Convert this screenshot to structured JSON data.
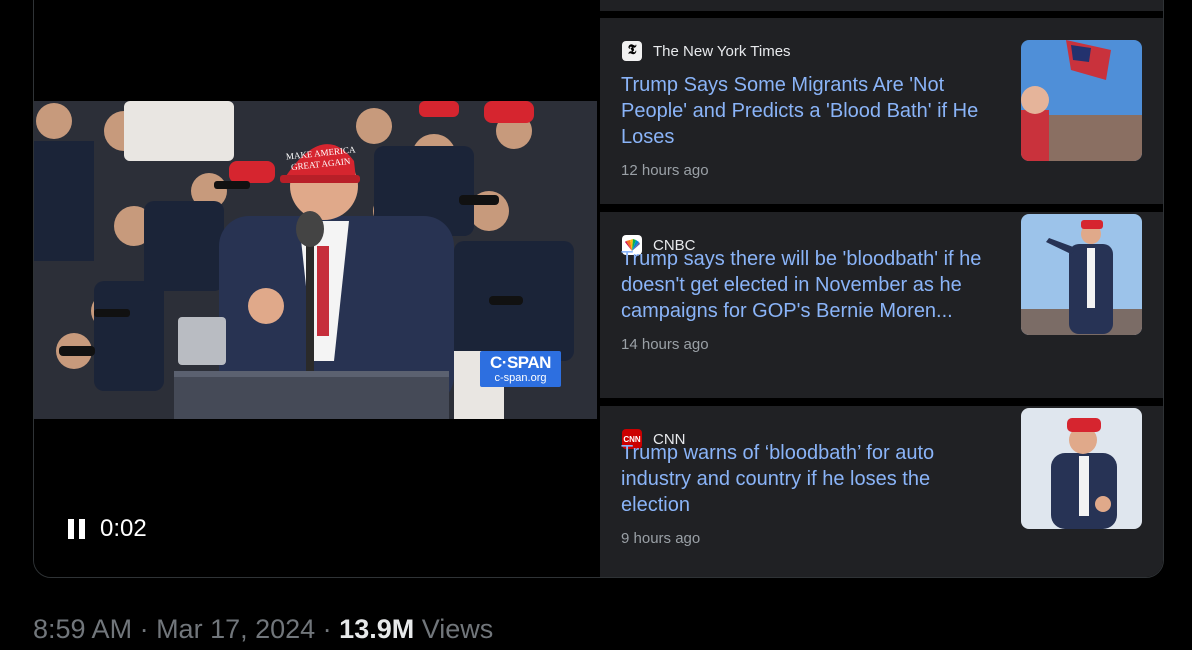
{
  "video": {
    "elapsed": "0:02",
    "channel_brand": "C·SPAN",
    "channel_url": "c-span.org"
  },
  "news": [
    {
      "source": "The New York Times",
      "icon": "nyt-logo",
      "headline": "Trump Says Some Migrants Are 'Not People' and Predicts a 'Blood Bath' if He Loses",
      "ago": "12 hours ago"
    },
    {
      "source": "CNBC",
      "icon": "cnbc-peacock-logo",
      "headline": "Trump says there will be 'bloodbath' if he doesn't get elected in November as he campaigns for GOP's Bernie Moren...",
      "ago": "14 hours ago"
    },
    {
      "source": "CNN",
      "icon": "cnn-logo",
      "headline": "Trump warns of ‘bloodbath’ for auto industry and country if he loses the election",
      "ago": "9 hours ago"
    }
  ],
  "footer": {
    "time": "8:59 AM",
    "sep1": " · ",
    "date": "Mar 17, 2024",
    "sep2": " · ",
    "views_count": "13.9M",
    "views_label": " Views"
  },
  "colors": {
    "headline": "#8ab4f8",
    "card_bg": "#202124",
    "cspan_blue": "#2d6fe0"
  }
}
